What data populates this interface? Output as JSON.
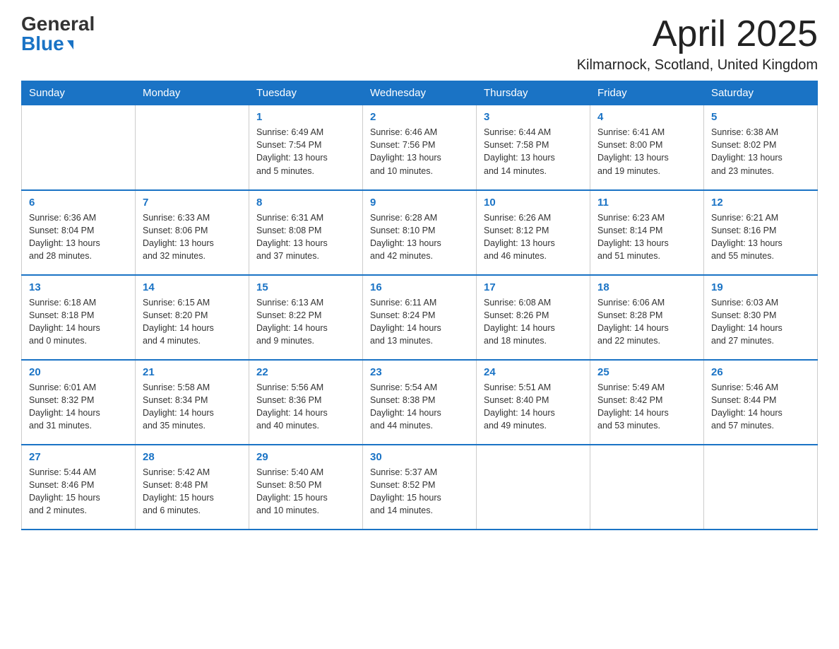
{
  "header": {
    "logo_general": "General",
    "logo_blue": "Blue",
    "title": "April 2025",
    "subtitle": "Kilmarnock, Scotland, United Kingdom"
  },
  "weekdays": [
    "Sunday",
    "Monday",
    "Tuesday",
    "Wednesday",
    "Thursday",
    "Friday",
    "Saturday"
  ],
  "weeks": [
    [
      {
        "day": "",
        "info": ""
      },
      {
        "day": "",
        "info": ""
      },
      {
        "day": "1",
        "info": "Sunrise: 6:49 AM\nSunset: 7:54 PM\nDaylight: 13 hours\nand 5 minutes."
      },
      {
        "day": "2",
        "info": "Sunrise: 6:46 AM\nSunset: 7:56 PM\nDaylight: 13 hours\nand 10 minutes."
      },
      {
        "day": "3",
        "info": "Sunrise: 6:44 AM\nSunset: 7:58 PM\nDaylight: 13 hours\nand 14 minutes."
      },
      {
        "day": "4",
        "info": "Sunrise: 6:41 AM\nSunset: 8:00 PM\nDaylight: 13 hours\nand 19 minutes."
      },
      {
        "day": "5",
        "info": "Sunrise: 6:38 AM\nSunset: 8:02 PM\nDaylight: 13 hours\nand 23 minutes."
      }
    ],
    [
      {
        "day": "6",
        "info": "Sunrise: 6:36 AM\nSunset: 8:04 PM\nDaylight: 13 hours\nand 28 minutes."
      },
      {
        "day": "7",
        "info": "Sunrise: 6:33 AM\nSunset: 8:06 PM\nDaylight: 13 hours\nand 32 minutes."
      },
      {
        "day": "8",
        "info": "Sunrise: 6:31 AM\nSunset: 8:08 PM\nDaylight: 13 hours\nand 37 minutes."
      },
      {
        "day": "9",
        "info": "Sunrise: 6:28 AM\nSunset: 8:10 PM\nDaylight: 13 hours\nand 42 minutes."
      },
      {
        "day": "10",
        "info": "Sunrise: 6:26 AM\nSunset: 8:12 PM\nDaylight: 13 hours\nand 46 minutes."
      },
      {
        "day": "11",
        "info": "Sunrise: 6:23 AM\nSunset: 8:14 PM\nDaylight: 13 hours\nand 51 minutes."
      },
      {
        "day": "12",
        "info": "Sunrise: 6:21 AM\nSunset: 8:16 PM\nDaylight: 13 hours\nand 55 minutes."
      }
    ],
    [
      {
        "day": "13",
        "info": "Sunrise: 6:18 AM\nSunset: 8:18 PM\nDaylight: 14 hours\nand 0 minutes."
      },
      {
        "day": "14",
        "info": "Sunrise: 6:15 AM\nSunset: 8:20 PM\nDaylight: 14 hours\nand 4 minutes."
      },
      {
        "day": "15",
        "info": "Sunrise: 6:13 AM\nSunset: 8:22 PM\nDaylight: 14 hours\nand 9 minutes."
      },
      {
        "day": "16",
        "info": "Sunrise: 6:11 AM\nSunset: 8:24 PM\nDaylight: 14 hours\nand 13 minutes."
      },
      {
        "day": "17",
        "info": "Sunrise: 6:08 AM\nSunset: 8:26 PM\nDaylight: 14 hours\nand 18 minutes."
      },
      {
        "day": "18",
        "info": "Sunrise: 6:06 AM\nSunset: 8:28 PM\nDaylight: 14 hours\nand 22 minutes."
      },
      {
        "day": "19",
        "info": "Sunrise: 6:03 AM\nSunset: 8:30 PM\nDaylight: 14 hours\nand 27 minutes."
      }
    ],
    [
      {
        "day": "20",
        "info": "Sunrise: 6:01 AM\nSunset: 8:32 PM\nDaylight: 14 hours\nand 31 minutes."
      },
      {
        "day": "21",
        "info": "Sunrise: 5:58 AM\nSunset: 8:34 PM\nDaylight: 14 hours\nand 35 minutes."
      },
      {
        "day": "22",
        "info": "Sunrise: 5:56 AM\nSunset: 8:36 PM\nDaylight: 14 hours\nand 40 minutes."
      },
      {
        "day": "23",
        "info": "Sunrise: 5:54 AM\nSunset: 8:38 PM\nDaylight: 14 hours\nand 44 minutes."
      },
      {
        "day": "24",
        "info": "Sunrise: 5:51 AM\nSunset: 8:40 PM\nDaylight: 14 hours\nand 49 minutes."
      },
      {
        "day": "25",
        "info": "Sunrise: 5:49 AM\nSunset: 8:42 PM\nDaylight: 14 hours\nand 53 minutes."
      },
      {
        "day": "26",
        "info": "Sunrise: 5:46 AM\nSunset: 8:44 PM\nDaylight: 14 hours\nand 57 minutes."
      }
    ],
    [
      {
        "day": "27",
        "info": "Sunrise: 5:44 AM\nSunset: 8:46 PM\nDaylight: 15 hours\nand 2 minutes."
      },
      {
        "day": "28",
        "info": "Sunrise: 5:42 AM\nSunset: 8:48 PM\nDaylight: 15 hours\nand 6 minutes."
      },
      {
        "day": "29",
        "info": "Sunrise: 5:40 AM\nSunset: 8:50 PM\nDaylight: 15 hours\nand 10 minutes."
      },
      {
        "day": "30",
        "info": "Sunrise: 5:37 AM\nSunset: 8:52 PM\nDaylight: 15 hours\nand 14 minutes."
      },
      {
        "day": "",
        "info": ""
      },
      {
        "day": "",
        "info": ""
      },
      {
        "day": "",
        "info": ""
      }
    ]
  ]
}
